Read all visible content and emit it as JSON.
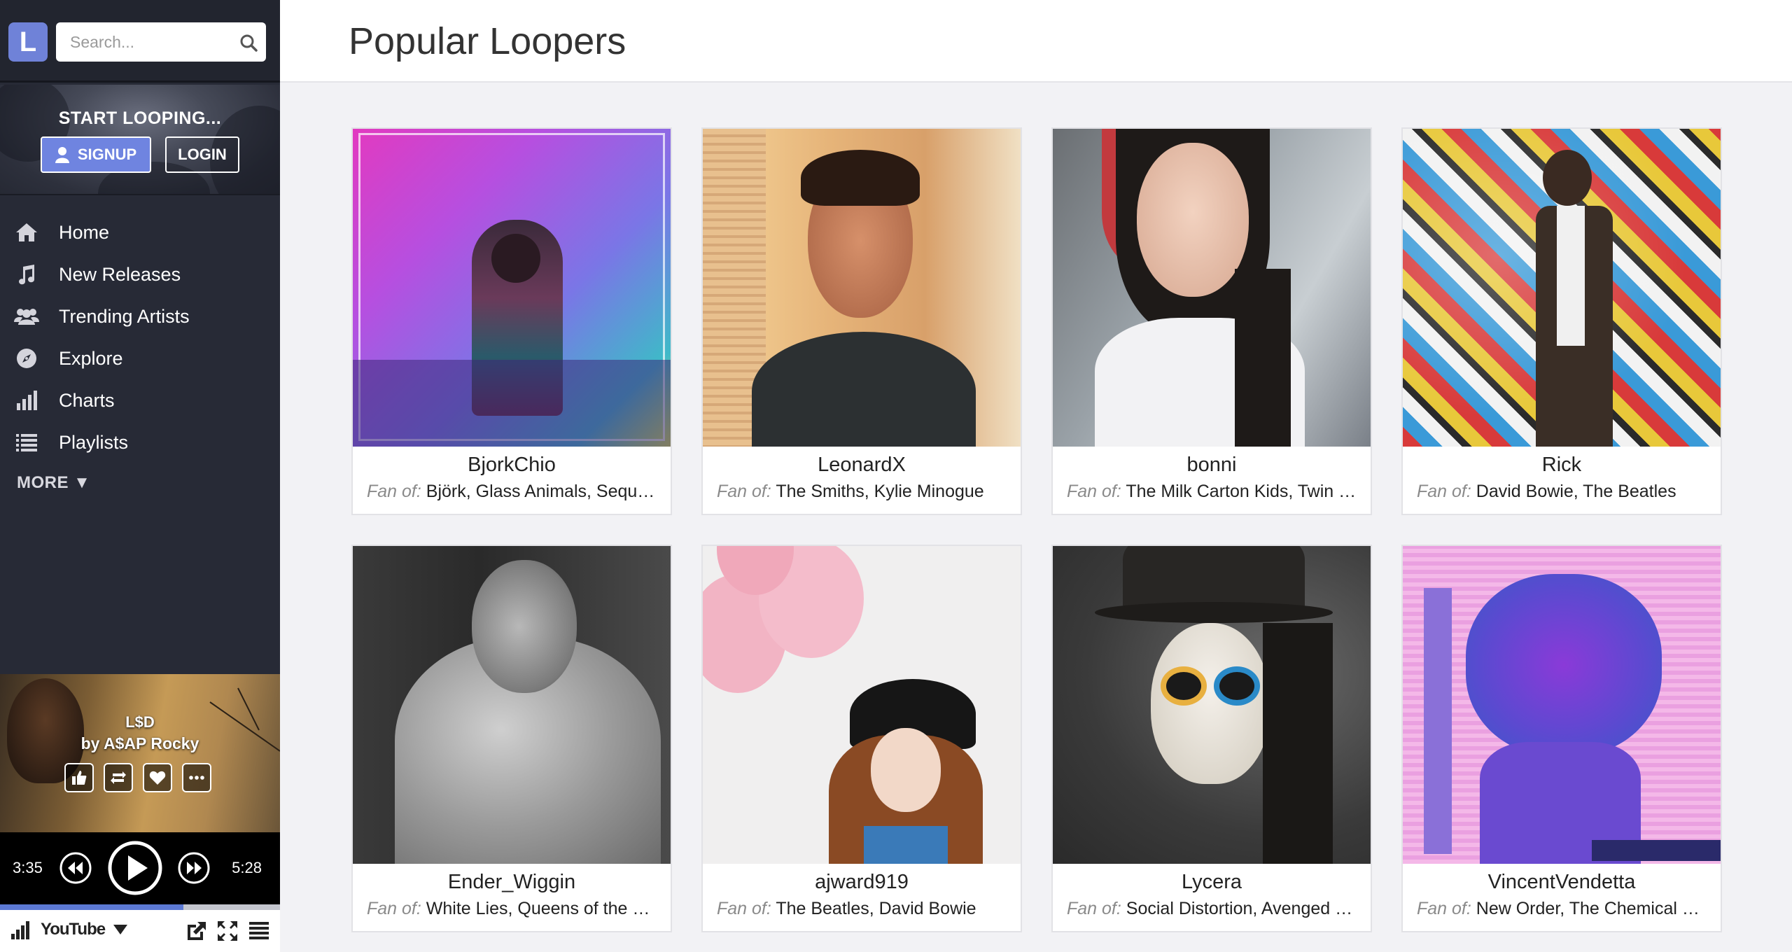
{
  "search": {
    "placeholder": "Search..."
  },
  "logo": {
    "letter": "L"
  },
  "promo": {
    "title": "START LOOPING...",
    "signup": "SIGNUP",
    "login": "LOGIN"
  },
  "nav": {
    "items": [
      {
        "label": "Home",
        "icon": "home-icon"
      },
      {
        "label": "New Releases",
        "icon": "music-note-icon"
      },
      {
        "label": "Trending Artists",
        "icon": "users-icon"
      },
      {
        "label": "Explore",
        "icon": "compass-icon"
      },
      {
        "label": "Charts",
        "icon": "bar-chart-icon"
      },
      {
        "label": "Playlists",
        "icon": "list-icon"
      }
    ],
    "more": "MORE ▼"
  },
  "player": {
    "title": "L$D",
    "artist": "by A$AP Rocky",
    "current_time": "3:35",
    "total_time": "5:28",
    "progress": 0.655,
    "source_label": "YouTube"
  },
  "page": {
    "title": "Popular Loopers"
  },
  "fan_label": "Fan of:",
  "loopers": [
    {
      "name": "BjorkChio",
      "fans": "Björk, Glass Animals, Sequence"
    },
    {
      "name": "LeonardX",
      "fans": "The Smiths, Kylie Minogue"
    },
    {
      "name": "bonni",
      "fans": "The Milk Carton Kids, Twin Shadow"
    },
    {
      "name": "Rick",
      "fans": "David Bowie, The Beatles"
    },
    {
      "name": "Ender_Wiggin",
      "fans": "White Lies, Queens of the Stone Age"
    },
    {
      "name": "ajward919",
      "fans": "The Beatles, David Bowie"
    },
    {
      "name": "Lycera",
      "fans": "Social Distortion, Avenged Sevenfold"
    },
    {
      "name": "VincentVendetta",
      "fans": "New Order, The Chemical Brothers"
    }
  ],
  "colors": {
    "sidebar": "#272a36",
    "accent": "#6f84e0",
    "progress": "#5c79d4"
  }
}
